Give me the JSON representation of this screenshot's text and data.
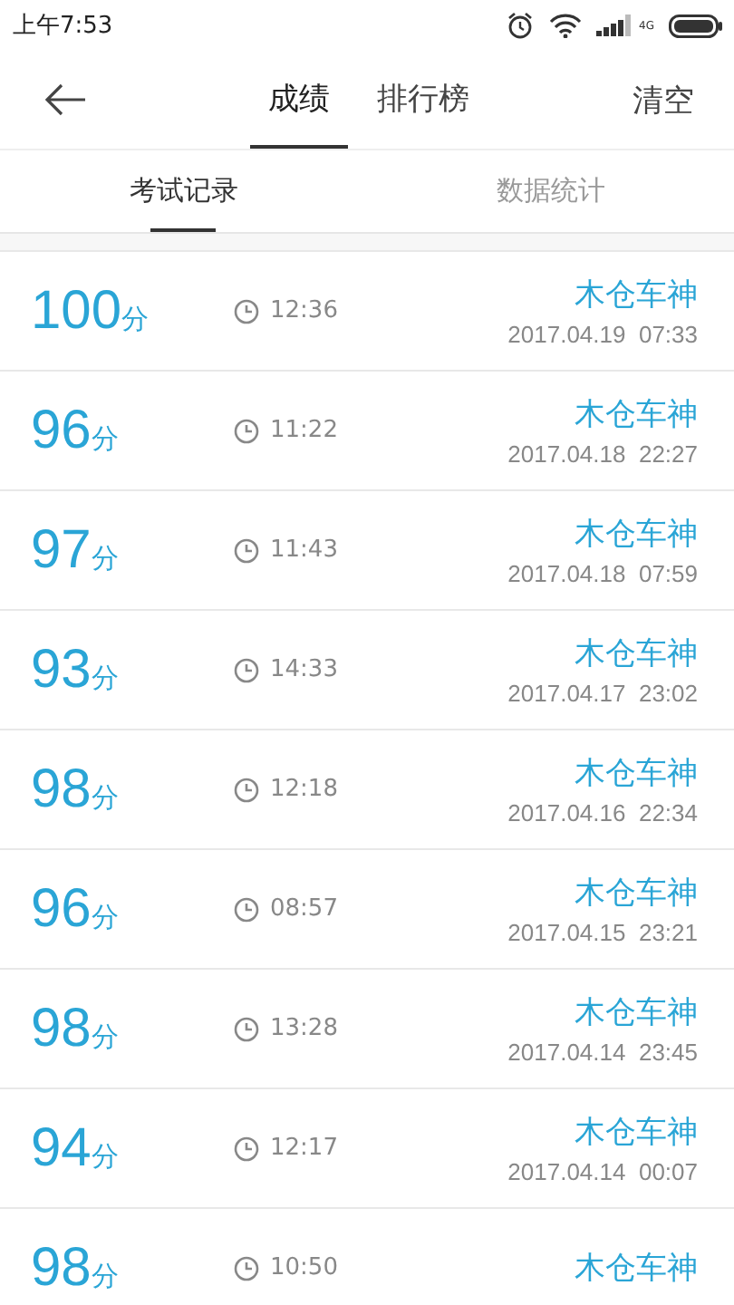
{
  "status_bar": {
    "time": "上午7:53",
    "network": "4G"
  },
  "header": {
    "tabs": [
      {
        "label": "成绩",
        "selected": true
      },
      {
        "label": "排行榜",
        "selected": false
      }
    ],
    "action": "清空"
  },
  "subtabs": [
    {
      "label": "考试记录",
      "selected": true
    },
    {
      "label": "数据统计",
      "selected": false
    }
  ],
  "records": [
    {
      "score": "100",
      "unit": "分",
      "duration": "12:36",
      "name": "木仓车神",
      "date": "2017.04.19  07:33"
    },
    {
      "score": "96",
      "unit": "分",
      "duration": "11:22",
      "name": "木仓车神",
      "date": "2017.04.18  22:27"
    },
    {
      "score": "97",
      "unit": "分",
      "duration": "11:43",
      "name": "木仓车神",
      "date": "2017.04.18  07:59"
    },
    {
      "score": "93",
      "unit": "分",
      "duration": "14:33",
      "name": "木仓车神",
      "date": "2017.04.17  23:02"
    },
    {
      "score": "98",
      "unit": "分",
      "duration": "12:18",
      "name": "木仓车神",
      "date": "2017.04.16  22:34"
    },
    {
      "score": "96",
      "unit": "分",
      "duration": "08:57",
      "name": "木仓车神",
      "date": "2017.04.15  23:21"
    },
    {
      "score": "98",
      "unit": "分",
      "duration": "13:28",
      "name": "木仓车神",
      "date": "2017.04.14  23:45"
    },
    {
      "score": "94",
      "unit": "分",
      "duration": "12:17",
      "name": "木仓车神",
      "date": "2017.04.14  00:07"
    },
    {
      "score": "98",
      "unit": "分",
      "duration": "10:50",
      "name": "木仓车神"
    }
  ]
}
